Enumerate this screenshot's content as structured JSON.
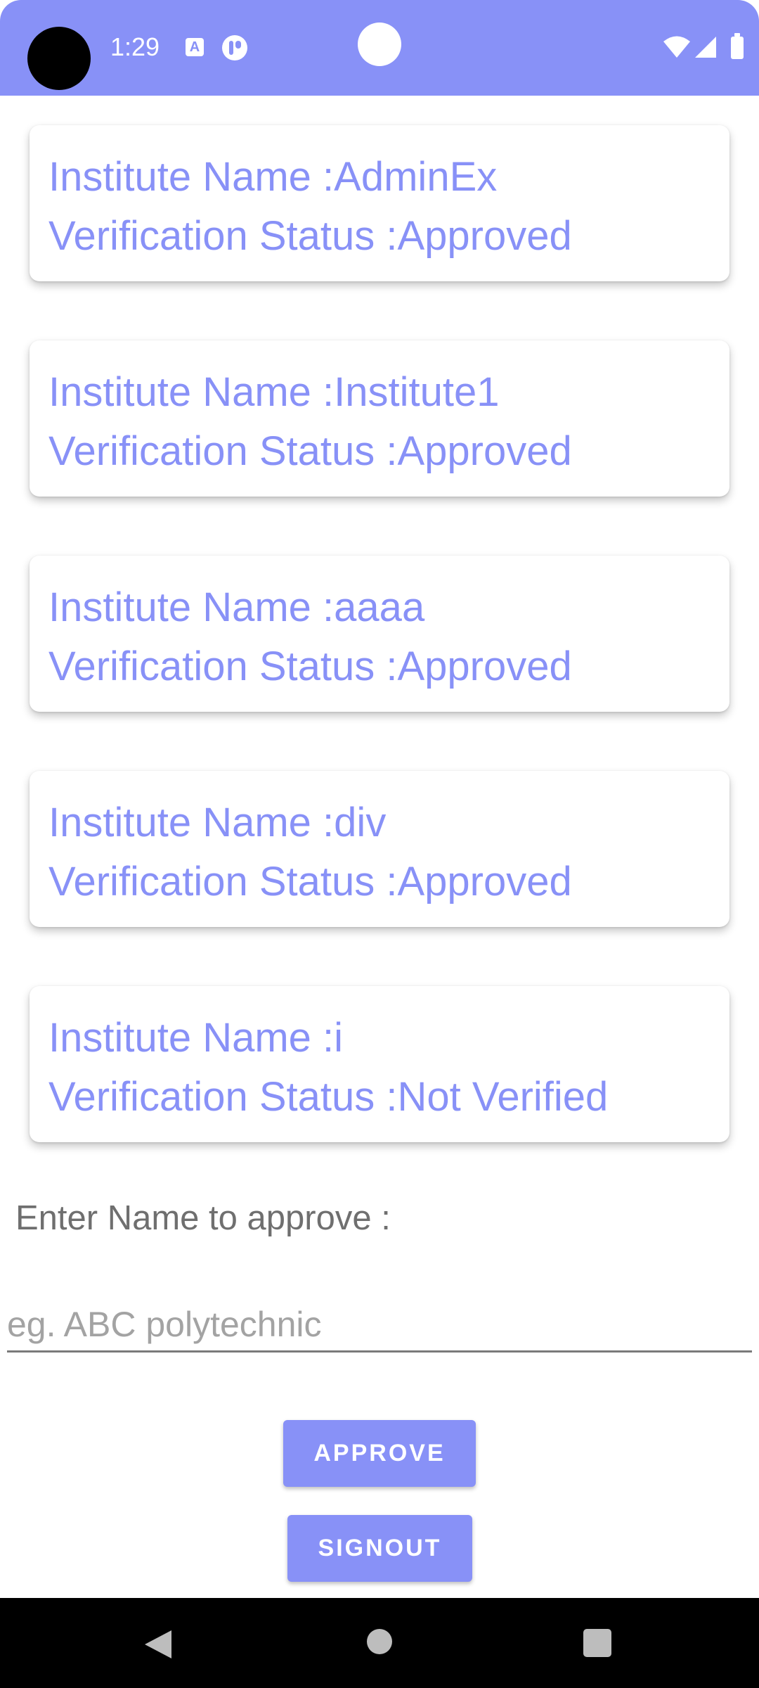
{
  "status_bar": {
    "time": "1:29",
    "icon_a_letter": "A"
  },
  "institutes": [
    {
      "name_line": "Institute Name :AdminEx",
      "status_line": "Verification Status :Approved"
    },
    {
      "name_line": "Institute Name :Institute1",
      "status_line": "Verification Status :Approved"
    },
    {
      "name_line": "Institute Name :aaaa",
      "status_line": "Verification Status :Approved"
    },
    {
      "name_line": "Institute Name :div",
      "status_line": "Verification Status :Approved"
    },
    {
      "name_line": "Institute Name :i",
      "status_line": "Verification Status :Not Verified"
    }
  ],
  "form": {
    "label": "Enter Name to approve :",
    "input_value": "",
    "input_placeholder": "eg. ABC polytechnic"
  },
  "buttons": {
    "approve": "APPROVE",
    "signout": "SIGNOUT"
  },
  "colors": {
    "accent": "#8891f7",
    "label_gray": "#6f6f6f",
    "placeholder_gray": "#a3a3a3",
    "nav_bar": "#000000"
  },
  "icons": {
    "status_bar": [
      "text-a-icon",
      "app-notification-icon",
      "wifi-icon",
      "signal-icon",
      "battery-icon"
    ],
    "nav_bar": [
      "back-icon",
      "home-icon",
      "recents-icon"
    ]
  }
}
